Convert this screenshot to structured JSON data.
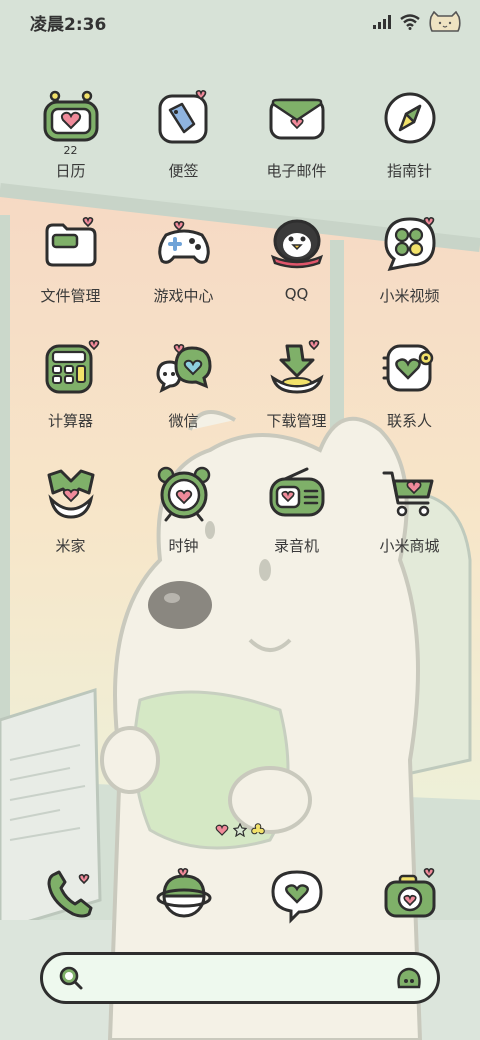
{
  "status_bar": {
    "time": "凌晨2:36"
  },
  "apps": [
    {
      "label": "日历",
      "icon": "calendar-icon",
      "badge_text": "22"
    },
    {
      "label": "便签",
      "icon": "notes-icon"
    },
    {
      "label": "电子邮件",
      "icon": "email-icon"
    },
    {
      "label": "指南针",
      "icon": "compass-icon"
    },
    {
      "label": "文件管理",
      "icon": "folder-icon"
    },
    {
      "label": "游戏中心",
      "icon": "gamepad-icon"
    },
    {
      "label": "QQ",
      "icon": "penguin-icon"
    },
    {
      "label": "小米视频",
      "icon": "video-icon"
    },
    {
      "label": "计算器",
      "icon": "calculator-icon"
    },
    {
      "label": "微信",
      "icon": "chat-bubbles-icon"
    },
    {
      "label": "下载管理",
      "icon": "download-icon"
    },
    {
      "label": "联系人",
      "icon": "contacts-icon"
    },
    {
      "label": "米家",
      "icon": "home-icon"
    },
    {
      "label": "时钟",
      "icon": "alarm-clock-icon"
    },
    {
      "label": "录音机",
      "icon": "radio-icon"
    },
    {
      "label": "小米商城",
      "icon": "shopping-cart-icon"
    }
  ],
  "dock": [
    {
      "icon": "phone-icon"
    },
    {
      "icon": "planet-icon"
    },
    {
      "icon": "message-heart-icon"
    },
    {
      "icon": "camera-icon"
    }
  ],
  "search": {
    "value": "",
    "left_icon": "search-icon",
    "right_icon": "assistant-icon"
  },
  "theme": {
    "accent_green": "#7fb069",
    "heart_pink": "#f08a9a",
    "outline": "#2e2e2e",
    "yellow": "#f2e26a"
  }
}
